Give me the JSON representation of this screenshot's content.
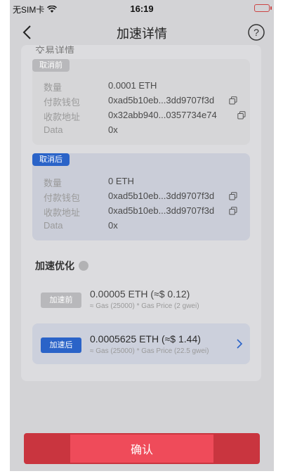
{
  "status": {
    "carrier": "无SIM卡",
    "time": "16:19"
  },
  "nav": {
    "title": "加速详情"
  },
  "tx_section_label": "交易详情",
  "before": {
    "tag": "取消前",
    "rows": [
      {
        "label": "数量",
        "value": "0.0001 ETH"
      },
      {
        "label": "付款钱包",
        "value": "0xad5b10eb...3dd9707f3d"
      },
      {
        "label": "收款地址",
        "value": "0x32abb940...0357734e74"
      },
      {
        "label": "Data",
        "value": "0x"
      }
    ]
  },
  "after": {
    "tag": "取消后",
    "rows": [
      {
        "label": "数量",
        "value": "0 ETH"
      },
      {
        "label": "付款钱包",
        "value": "0xad5b10eb...3dd9707f3d"
      },
      {
        "label": "收款地址",
        "value": "0xad5b10eb...3dd9707f3d"
      },
      {
        "label": "Data",
        "value": "0x"
      }
    ]
  },
  "speedup": {
    "title": "加速优化",
    "options": [
      {
        "button": "加速前",
        "amount": "0.00005 ETH (≈$ 0.12)",
        "detail": "≈ Gas (25000) * Gas Price (2 gwei)"
      },
      {
        "button": "加速后",
        "amount": "0.0005625 ETH (≈$ 1.44)",
        "detail": "≈ Gas (25000) * Gas Price (22.5 gwei)"
      }
    ]
  },
  "confirm_label": "确认",
  "colors": {
    "primary_blue": "#2a63c8",
    "confirm_red": "#ef4b5a"
  }
}
